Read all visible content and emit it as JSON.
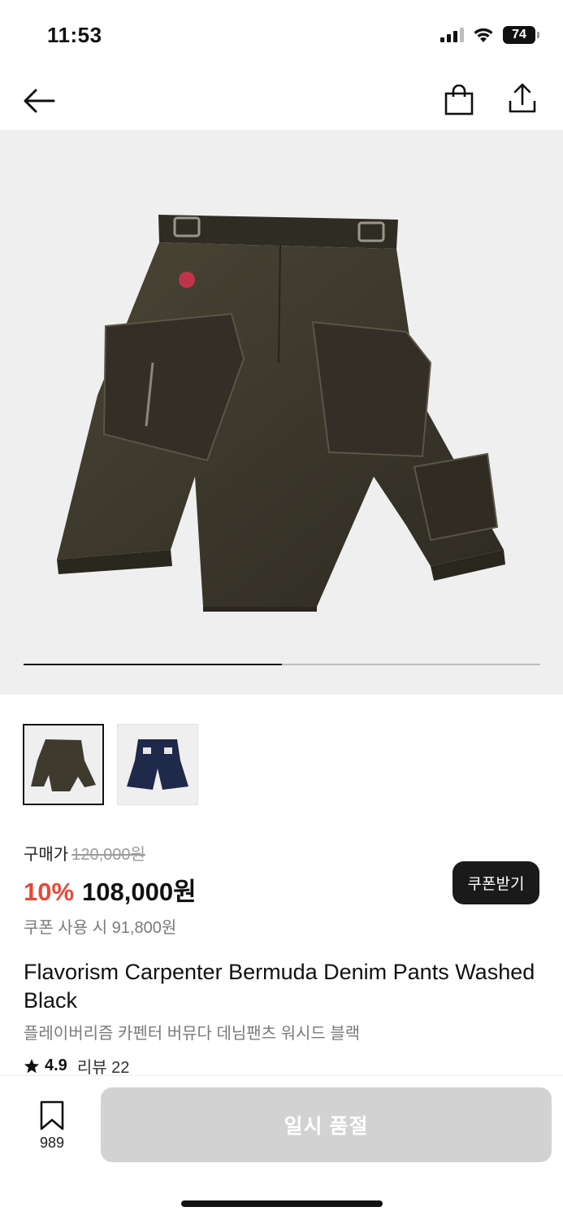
{
  "status_bar": {
    "time": "11:53",
    "battery": "74"
  },
  "nav": {
    "back_icon": "arrow-left-icon",
    "bag_icon": "shopping-bag-icon",
    "share_icon": "share-icon"
  },
  "gallery": {
    "current_index": 1,
    "total": 2
  },
  "thumbnails": [
    {
      "name": "washed-black-shorts",
      "selected": true
    },
    {
      "name": "navy-denim-shorts",
      "selected": false
    }
  ],
  "price": {
    "purchase_label": "구매가",
    "original_price": "120,000원",
    "discount": "10%",
    "sale_price": "108,000원",
    "coupon_price_text": "쿠폰 사용 시 91,800원",
    "coupon_button": "쿠폰받기"
  },
  "product": {
    "title": "Flavorism Carpenter Bermuda Denim Pants Washed Black",
    "subtitle": "플레이버리즘 카펜터 버뮤다 데님팬츠 워시드 블랙",
    "rating": "4.9",
    "review_label": "리뷰 22"
  },
  "bottom_bar": {
    "wishlist_count": "989",
    "soldout_label": "일시 품절"
  },
  "colors": {
    "discount": "#e8473a",
    "dark_button": "#1a1a1a",
    "disabled_button": "#d2d2d2"
  }
}
